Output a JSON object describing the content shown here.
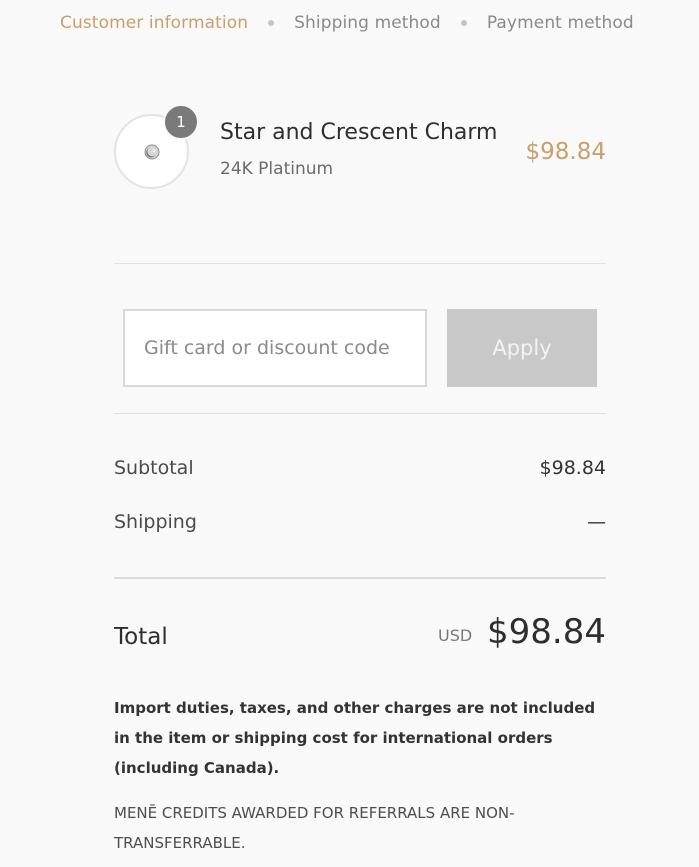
{
  "breadcrumb": {
    "step1": "Customer information",
    "step2": "Shipping method",
    "step3": "Payment method"
  },
  "product": {
    "name": "Star and Crescent Charm",
    "variant": "24K Platinum",
    "price": "$98.84",
    "quantity": "1"
  },
  "discount": {
    "placeholder": "Gift card or discount code",
    "apply_label": "Apply"
  },
  "summary": {
    "subtotal_label": "Subtotal",
    "subtotal_value": "$98.84",
    "shipping_label": "Shipping",
    "shipping_value": "—"
  },
  "total": {
    "label": "Total",
    "currency": "USD",
    "value": "$98.84"
  },
  "notices": {
    "import_duties": "Import duties, taxes, and other charges are not included in the item or shipping cost for international orders (including Canada).",
    "credits": "MENĒ CREDITS AWARDED FOR REFERRALS ARE NON-TRANSFERRABLE."
  },
  "colors": {
    "accent": "#c7a06a",
    "background": "#f9f9f9",
    "apply_button": "#c8c8c8"
  }
}
